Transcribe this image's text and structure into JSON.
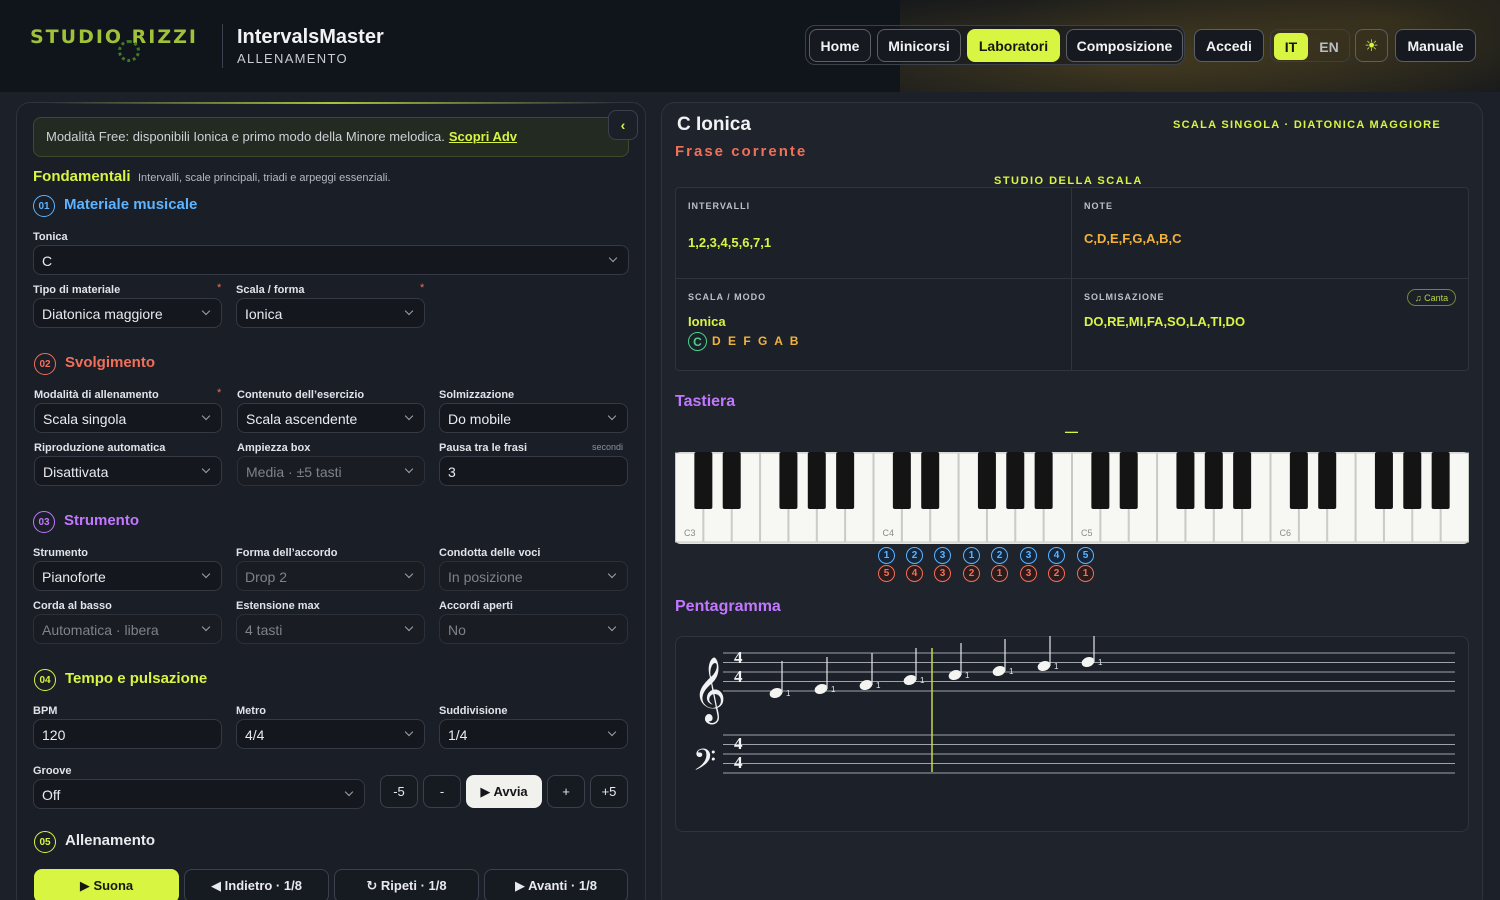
{
  "header": {
    "logo_text": "STUDIO RIZZI",
    "app_title": "IntervalsMaster",
    "app_subtitle": "ALLENAMENTO",
    "nav": [
      "Home",
      "Minicorsi",
      "Laboratori",
      "Composizione"
    ],
    "active_nav": "Laboratori",
    "login": "Accedi",
    "lang_it": "IT",
    "lang_en": "EN",
    "theme_icon": "sun-icon",
    "manual": "Manuale"
  },
  "left": {
    "notice_text": "Modalità Free: disponibili Ionica e primo modo della Minore melodica.",
    "notice_link": "Scopri Adv",
    "collapse_icon": "‹",
    "group_title": "Fondamentali",
    "group_desc": "Intervalli, scale principali, triadi e arpeggi essenziali.",
    "s1": {
      "num": "01",
      "title": "Materiale musicale",
      "tonica_label": "Tonica",
      "tonica_value": "C",
      "tipo_label": "Tipo di materiale",
      "tipo_value": "Diatonica maggiore",
      "scala_label": "Scala / forma",
      "scala_value": "Ionica"
    },
    "s2": {
      "num": "02",
      "title": "Svolgimento",
      "mod_label": "Modalità di allenamento",
      "mod_value": "Scala singola",
      "cont_label": "Contenuto dell’esercizio",
      "cont_value": "Scala ascendente",
      "solm_label": "Solmizzazione",
      "solm_value": "Do mobile",
      "rip_label": "Riproduzione automatica",
      "rip_value": "Disattivata",
      "amp_label": "Ampiezza box",
      "amp_value": "Media · ±5 tasti",
      "pausa_label": "Pausa tra le frasi",
      "pausa_unit": "secondi",
      "pausa_value": "3"
    },
    "s3": {
      "num": "03",
      "title": "Strumento",
      "str_label": "Strumento",
      "str_value": "Pianoforte",
      "forma_label": "Forma dell’accordo",
      "forma_value": "Drop 2",
      "cond_label": "Condotta delle voci",
      "cond_value": "In posizione",
      "corda_label": "Corda al basso",
      "corda_value": "Automatica · libera",
      "est_label": "Estensione max",
      "est_value": "4 tasti",
      "acc_label": "Accordi aperti",
      "acc_value": "No"
    },
    "s4": {
      "num": "04",
      "title": "Tempo e pulsazione",
      "bpm_label": "BPM",
      "bpm_value": "120",
      "metro_label": "Metro",
      "metro_value": "4/4",
      "sudd_label": "Suddivisione",
      "sudd_value": "1/4",
      "groove_label": "Groove",
      "groove_value": "Off",
      "btn_m5": "-5",
      "btn_m1": "-",
      "btn_play": "▶ Avvia",
      "btn_p1": "+",
      "btn_p5": "+5"
    },
    "s5": {
      "num": "05",
      "title": "Allenamento",
      "play": "▶ Suona",
      "back": "◀ Indietro · 1/8",
      "repeat": "↻ Ripeti · 1/8",
      "next": "▶ Avanti · 1/8"
    }
  },
  "right": {
    "title": "C Ionica",
    "subtitle": "Frase corrente",
    "tag": "SCALA SINGOLA · DIATONICA MAGGIORE",
    "study_title": "STUDIO DELLA SCALA",
    "intervalli_label": "INTERVALLI",
    "intervalli_value": "1,2,3,4,5,6,7,1",
    "note_label": "NOTE",
    "note_value": "C,D,E,F,G,A,B,C",
    "scala_label": "SCALA / MODO",
    "scala_value": "Ionica",
    "scala_root": "C",
    "scala_rest": "D E F G A B",
    "solm_label": "SOLMISAZIONE",
    "solm_value": "DO,RE,MI,FA,SO,LA,TI,DO",
    "canta": "♫ Canta",
    "tastiera_title": "Tastiera",
    "tastiera_dash": "—",
    "octave_labels": [
      "C3",
      "C4",
      "C5",
      "C6"
    ],
    "badges_top": [
      "1",
      "2",
      "3",
      "1",
      "2",
      "3",
      "4",
      "5"
    ],
    "badges_bottom": [
      "5",
      "4",
      "3",
      "2",
      "1",
      "3",
      "2",
      "1"
    ],
    "penta_title": "Pentagramma",
    "time_sig": "4",
    "treble_clef": "𝄞",
    "bass_clef": "𝄢",
    "fingering": [
      "1",
      "1",
      "1",
      "1",
      "1",
      "1",
      "1",
      "1"
    ]
  }
}
